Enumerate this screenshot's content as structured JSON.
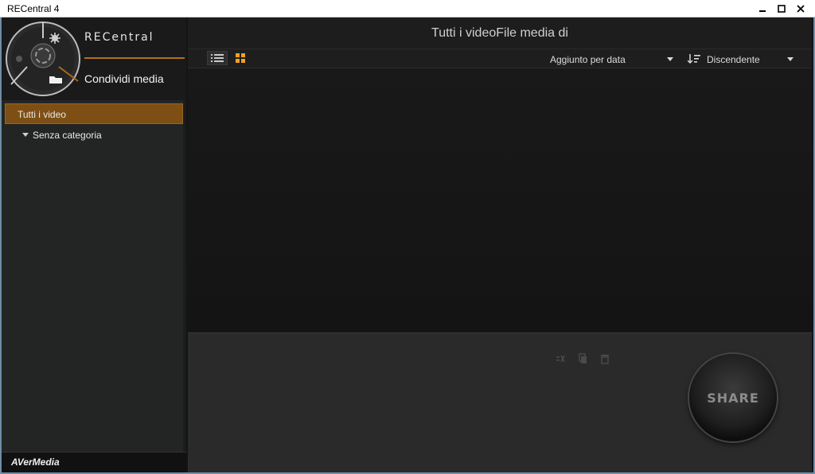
{
  "window": {
    "title": "RECentral 4"
  },
  "sidebar": {
    "brand": "RECentral",
    "mode_label": "Condividi media",
    "tree": [
      {
        "label": "Tutti i video",
        "selected": true
      },
      {
        "label": "Senza categoria",
        "selected": false
      }
    ],
    "footer_logo": "AVerMedia"
  },
  "main": {
    "title": "Tutti i videoFile media di",
    "sort_field": "Aggiunto per data",
    "sort_order": "Discendente",
    "share_label": "SHARE"
  },
  "colors": {
    "accent": "#b06f1c",
    "selected_bg": "#7e4f14",
    "grid_icon": "#f0a020"
  },
  "icons": [
    "minimize-icon",
    "maximize-icon",
    "close-icon",
    "gear-icon",
    "folder-icon",
    "list-view-icon",
    "grid-view-icon",
    "sort-descending-icon",
    "unlink-icon",
    "copy-icon",
    "trash-icon"
  ]
}
